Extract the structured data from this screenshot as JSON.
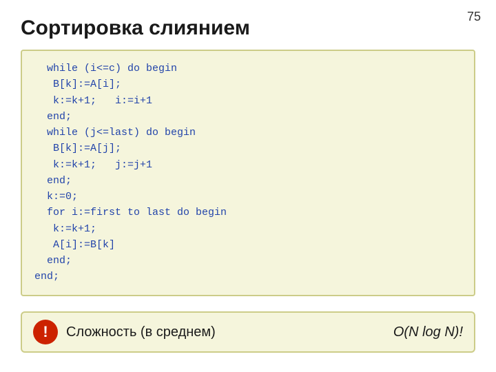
{
  "slide": {
    "number": "75",
    "title": "Сортировка слиянием",
    "code_lines": [
      "  while (i<=c) do begin",
      "   B[k]:=A[i];",
      "   k:=k+1;   i:=i+1",
      "  end;",
      "  while (j<=last) do begin",
      "   B[k]:=A[j];",
      "   k:=k+1;   j:=j+1",
      "  end;",
      "  k:=0;",
      "  for i:=first to last do begin",
      "   k:=k+1;",
      "   A[i]:=B[k]",
      "  end;",
      "end;"
    ],
    "bottom_bar": {
      "badge_text": "!",
      "label": "Сложность (в среднем)",
      "formula": "O(N log N)!"
    }
  }
}
